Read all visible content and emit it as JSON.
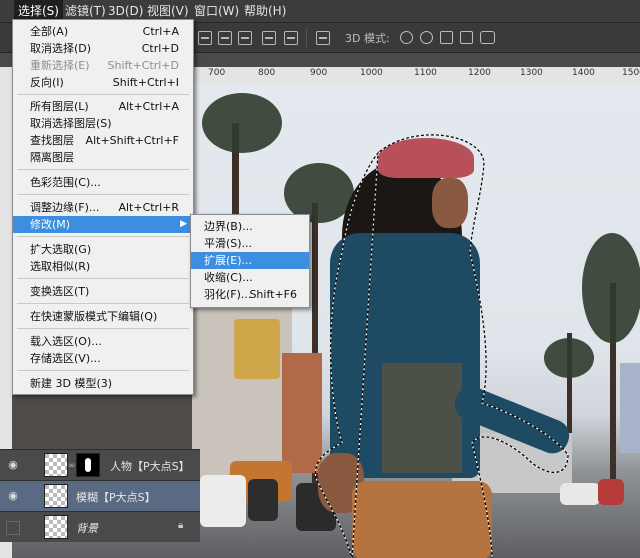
{
  "menubar": {
    "items": [
      "选择(S)",
      "滤镜(T)",
      "3D(D)",
      "视图(V)",
      "窗口(W)",
      "帮助(H)"
    ],
    "active_index": 0
  },
  "options_bar": {
    "mode_3d_label": "3D 模式:"
  },
  "ruler": {
    "ticks": [
      "700",
      "800",
      "900",
      "1000",
      "1100",
      "1200",
      "1300",
      "1400",
      "1500"
    ]
  },
  "select_menu": {
    "items": [
      {
        "label": "全部(A)",
        "shortcut": "Ctrl+A",
        "disabled": false
      },
      {
        "label": "取消选择(D)",
        "shortcut": "Ctrl+D",
        "disabled": false
      },
      {
        "label": "重新选择(E)",
        "shortcut": "Shift+Ctrl+D",
        "disabled": true
      },
      {
        "label": "反向(I)",
        "shortcut": "Shift+Ctrl+I",
        "disabled": false
      },
      {
        "label": "所有图层(L)",
        "shortcut": "Alt+Ctrl+A",
        "disabled": false
      },
      {
        "label": "取消选择图层(S)",
        "shortcut": "",
        "disabled": false
      },
      {
        "label": "查找图层",
        "shortcut": "Alt+Shift+Ctrl+F",
        "disabled": false
      },
      {
        "label": "隔离图层",
        "shortcut": "",
        "disabled": false
      },
      {
        "label": "色彩范围(C)...",
        "shortcut": "",
        "disabled": false
      },
      {
        "label": "调整边缘(F)...",
        "shortcut": "Alt+Ctrl+R",
        "disabled": false
      },
      {
        "label": "修改(M)",
        "shortcut": "",
        "disabled": false
      },
      {
        "label": "扩大选取(G)",
        "shortcut": "",
        "disabled": false
      },
      {
        "label": "选取相似(R)",
        "shortcut": "",
        "disabled": false
      },
      {
        "label": "变换选区(T)",
        "shortcut": "",
        "disabled": false
      },
      {
        "label": "在快速蒙版模式下编辑(Q)",
        "shortcut": "",
        "disabled": false
      },
      {
        "label": "载入选区(O)...",
        "shortcut": "",
        "disabled": false
      },
      {
        "label": "存储选区(V)...",
        "shortcut": "",
        "disabled": false
      },
      {
        "label": "新建 3D 模型(3)",
        "shortcut": "",
        "disabled": false
      }
    ],
    "highlighted_index": 10
  },
  "modify_submenu": {
    "items": [
      {
        "label": "边界(B)...",
        "shortcut": ""
      },
      {
        "label": "平滑(S)...",
        "shortcut": ""
      },
      {
        "label": "扩展(E)...",
        "shortcut": ""
      },
      {
        "label": "收缩(C)...",
        "shortcut": ""
      },
      {
        "label": "羽化(F)...",
        "shortcut": "Shift+F6"
      }
    ],
    "highlighted_index": 2
  },
  "layers": [
    {
      "name": "人物【P大点S】",
      "visible": true,
      "has_mask": true,
      "selected": false
    },
    {
      "name": "模糊【P大点S】",
      "visible": true,
      "has_mask": false,
      "selected": true
    },
    {
      "name": "背景",
      "visible": false,
      "has_mask": false,
      "selected": false,
      "locked": true
    }
  ],
  "colors": {
    "menu_highlight": "#3b8ee0",
    "layer_selected": "#5a6a82",
    "jacket": "#1e4a63",
    "cap": "#b8505a",
    "pants": "#b5733f"
  }
}
